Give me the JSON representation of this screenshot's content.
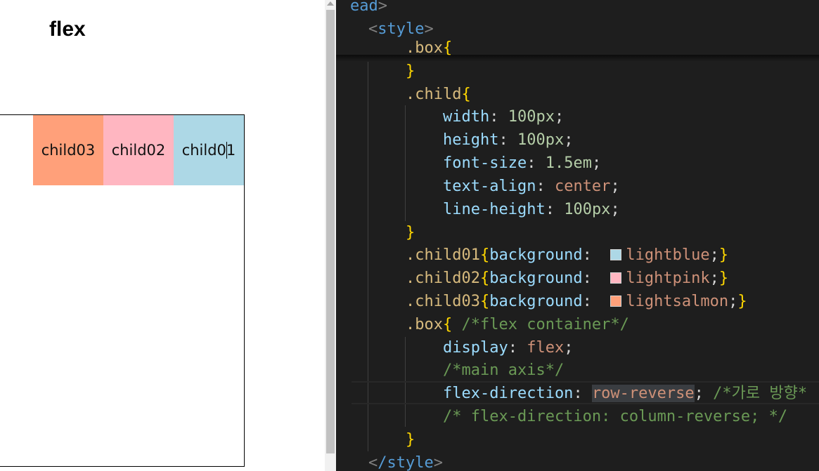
{
  "preview": {
    "title": "flex",
    "children": [
      {
        "label": "child01",
        "color": "#add8e6"
      },
      {
        "label": "child02",
        "color": "#ffb6c1"
      },
      {
        "label": "child03",
        "color": "#ffa07a"
      }
    ],
    "child01_label_before_caret": "child0",
    "child01_label_after_caret": "1"
  },
  "editor": {
    "line_head_tag": "ead",
    "line_style_open": "style",
    "line_box_sel": ".box",
    "line_child_sel": ".child",
    "width_prop": "width",
    "width_val": "100px",
    "height_prop": "height",
    "height_val": "100px",
    "fontsize_prop": "font-size",
    "fontsize_val": "1.5em",
    "textalign_prop": "text-align",
    "textalign_val": "center",
    "lineheight_prop": "line-height",
    "lineheight_val": "100px",
    "child01_sel": ".child01",
    "child01_prop": "background",
    "child01_val": "lightblue",
    "child01_swatch": "#add8e6",
    "child02_sel": ".child02",
    "child02_prop": "background",
    "child02_val": "lightpink",
    "child02_swatch": "#ffb6c1",
    "child03_sel": ".child03",
    "child03_prop": "background",
    "child03_val": "lightsalmon",
    "child03_swatch": "#ffa07a",
    "box2_sel": ".box",
    "box2_comment": "/*flex container*/",
    "display_prop": "display",
    "display_val": "flex",
    "main_axis_comment": "/*main axis*/",
    "fd_prop": "flex-direction",
    "fd_val": "row-reverse",
    "fd_comment": "/*가로 방향*",
    "fd_alt_comment": "/* flex-direction: column-reverse; */",
    "line_style_close": "/style"
  }
}
